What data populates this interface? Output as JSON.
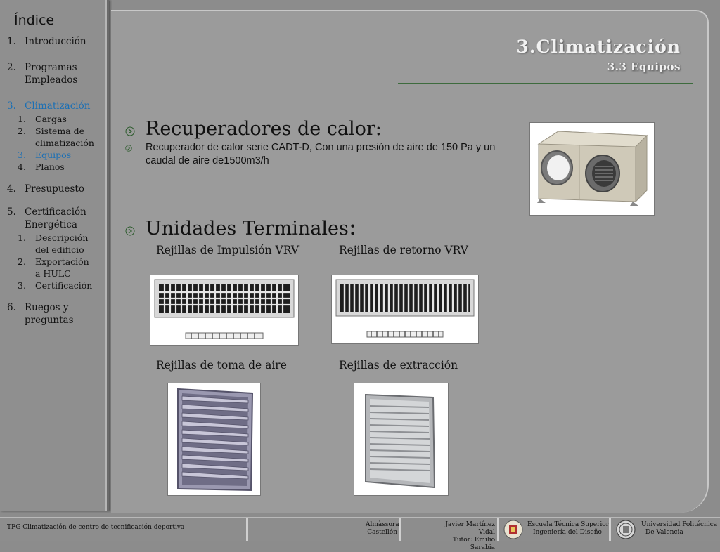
{
  "sidebar": {
    "title": "Índice",
    "items": [
      {
        "num": "1.",
        "label": "Introducción"
      },
      {
        "num": "2.",
        "label": "Programas Empleados"
      },
      {
        "num": "3.",
        "label": "Climatización"
      },
      {
        "num": "4.",
        "label": "Presupuesto"
      },
      {
        "num": "5.",
        "label": "Certificación Energética"
      },
      {
        "num": "6.",
        "label": "Ruegos y preguntas"
      }
    ],
    "sub3": [
      {
        "num": "1.",
        "label": "Cargas"
      },
      {
        "num": "2.",
        "label": "Sistema de climatización"
      },
      {
        "num": "3.",
        "label": "Equipos"
      },
      {
        "num": "4.",
        "label": "Planos"
      }
    ],
    "sub5": [
      {
        "num": "1.",
        "label": "Descripción del edificio"
      },
      {
        "num": "2.",
        "label": "Exportación a HULC"
      },
      {
        "num": "3.",
        "label": "Certificación"
      }
    ]
  },
  "header": {
    "title": "3.Climatización",
    "subtitle": "3.3 Equipos"
  },
  "content": {
    "recuperadores_heading": "Recuperadores de calor:",
    "recuperadores_text": "Recuperador de calor serie CADT-D, Con una presión de aire de 150 Pa y un caudal de aire de1500m3/h",
    "unidades_heading": "Unidades Terminales",
    "unidades_colon": ":",
    "labels": {
      "impulsion": "Rejillas de Impulsión VRV",
      "retorno": "Rejillas de retorno VRV",
      "toma": "Rejillas de toma de aire",
      "extraccion": "Rejillas de extracción"
    }
  },
  "footer": {
    "project": "TFG Climatización de centro de tecnificación deportiva",
    "location_1": "Almàssora",
    "location_2": "Castellón",
    "author_1": "Javier Martínez Vidal",
    "author_2": "Tutor: Emilio Sarabia",
    "school_1": "Escuela Técnica Superior",
    "school_2": "Ingeniería del Diseño",
    "university_1": "Universidad Politécnica",
    "university_2": "De Valencia"
  },
  "colors": {
    "active": "#1a6fb5",
    "rule": "#3d6b3d"
  }
}
